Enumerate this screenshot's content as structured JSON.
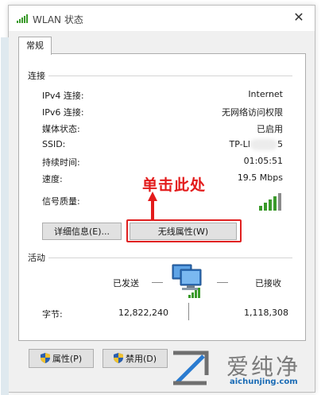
{
  "window": {
    "title": "WLAN 状态",
    "close": "✕"
  },
  "tab": {
    "label": "常规"
  },
  "connection": {
    "header": "连接",
    "rows": [
      {
        "label": "IPv4 连接:",
        "value": "Internet"
      },
      {
        "label": "IPv6 连接:",
        "value": "无网络访问权限"
      },
      {
        "label": "媒体状态:",
        "value": "已启用"
      },
      {
        "label": "SSID:",
        "value_prefix": "TP-LI",
        "value_suffix": "5"
      },
      {
        "label": "持续时间:",
        "value": "01:05:51"
      },
      {
        "label": "速度:",
        "value": "19.5 Mbps"
      },
      {
        "label": "信号质量:"
      }
    ],
    "signal_bars": 4
  },
  "buttons": {
    "details": "详细信息(E)...",
    "wireless_props": "无线属性(W)"
  },
  "annotation": {
    "text": "单击此处"
  },
  "activity": {
    "header": "活动",
    "sent_label": "已发送",
    "received_label": "已接收",
    "bytes_label": "字节:",
    "bytes_sent": "12,822,240",
    "bytes_received": "1,118,308"
  },
  "bottom": {
    "properties": "属性(P)",
    "disable": "禁用(D)"
  },
  "watermark": {
    "cn": "爱纯净",
    "en": "aichunjing.com"
  },
  "colors": {
    "annotation": "#e31b1b",
    "signal": "#3a9a2a",
    "watermark_blue": "#1a6bb5"
  }
}
